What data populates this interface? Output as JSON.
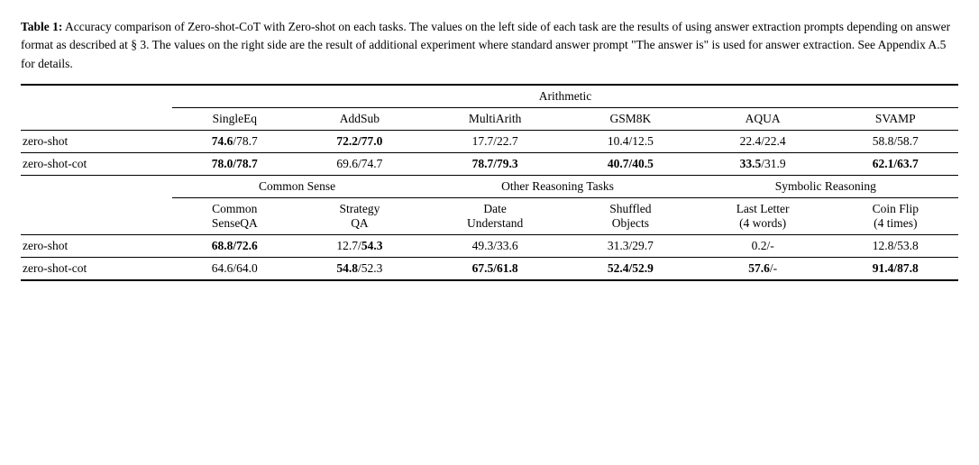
{
  "caption": {
    "label": "Table 1:",
    "text": " Accuracy comparison of Zero-shot-CoT with Zero-shot on each tasks. The values on the left side of each task are the results of using answer extraction prompts depending on answer format as described at § 3. The values on the right side are the result of additional experiment where standard answer prompt \"The answer is\" is used for answer extraction. See Appendix A.5 for details."
  },
  "groups": {
    "arithmetic": {
      "label": "Arithmetic",
      "colspan": 6
    },
    "commonsense": {
      "label": "Common Sense",
      "colspan": 2
    },
    "other": {
      "label": "Other Reasoning Tasks",
      "colspan": 2
    },
    "symbolic": {
      "label": "Symbolic Reasoning",
      "colspan": 2
    }
  },
  "arithmetic_subheaders": [
    "SingleEq",
    "AddSub",
    "MultiArith",
    "GSM8K",
    "AQUA",
    "SVAMP"
  ],
  "second_subheaders": [
    {
      "line1": "Common",
      "line2": "SenseQA"
    },
    {
      "line1": "Strategy",
      "line2": "QA"
    },
    {
      "line1": "Date",
      "line2": "Understand"
    },
    {
      "line1": "Shuffled",
      "line2": "Objects"
    },
    {
      "line1": "Last Letter",
      "line2": "(4 words)"
    },
    {
      "line1": "Coin Flip",
      "line2": "(4 times)"
    }
  ],
  "rows": {
    "section1": [
      {
        "label": "zero-shot",
        "values": [
          "74.6/78.7",
          "72.2/77.0",
          "17.7/22.7",
          "10.4/12.5",
          "22.4/22.4",
          "58.8/58.7"
        ],
        "bold": [
          true,
          true,
          false,
          false,
          false,
          false
        ],
        "bold_parts": [
          {
            "left": false,
            "right": true
          },
          {
            "left": true,
            "right": true
          },
          {
            "left": false,
            "right": false
          },
          {
            "left": false,
            "right": false
          },
          {
            "left": false,
            "right": false
          },
          {
            "left": false,
            "right": false
          }
        ]
      },
      {
        "label": "zero-shot-cot",
        "values": [
          "78.0/78.7",
          "69.6/74.7",
          "78.7/79.3",
          "40.7/40.5",
          "33.5/31.9",
          "62.1/63.7"
        ],
        "bold_parts": [
          {
            "left": true,
            "right": true
          },
          {
            "left": false,
            "right": false
          },
          {
            "left": true,
            "right": true
          },
          {
            "left": true,
            "right": true
          },
          {
            "left": true,
            "right": false
          },
          {
            "left": true,
            "right": true
          }
        ]
      }
    ],
    "section2": [
      {
        "label": "zero-shot",
        "values": [
          "68.8/72.6",
          "12.7/54.3",
          "49.3/33.6",
          "31.3/29.7",
          "0.2/-",
          "12.8/53.8"
        ],
        "bold_parts": [
          {
            "left": true,
            "right": true
          },
          {
            "left": false,
            "right": true
          },
          {
            "left": false,
            "right": false
          },
          {
            "left": false,
            "right": false
          },
          {
            "left": false,
            "right": false
          },
          {
            "left": false,
            "right": false
          }
        ]
      },
      {
        "label": "zero-shot-cot",
        "values": [
          "64.6/64.0",
          "54.8/52.3",
          "67.5/61.8",
          "52.4/52.9",
          "57.6/-",
          "91.4/87.8"
        ],
        "bold_parts": [
          {
            "left": false,
            "right": false
          },
          {
            "left": true,
            "right": false
          },
          {
            "left": true,
            "right": true
          },
          {
            "left": true,
            "right": true
          },
          {
            "left": true,
            "right": false
          },
          {
            "left": true,
            "right": true
          }
        ]
      }
    ]
  }
}
